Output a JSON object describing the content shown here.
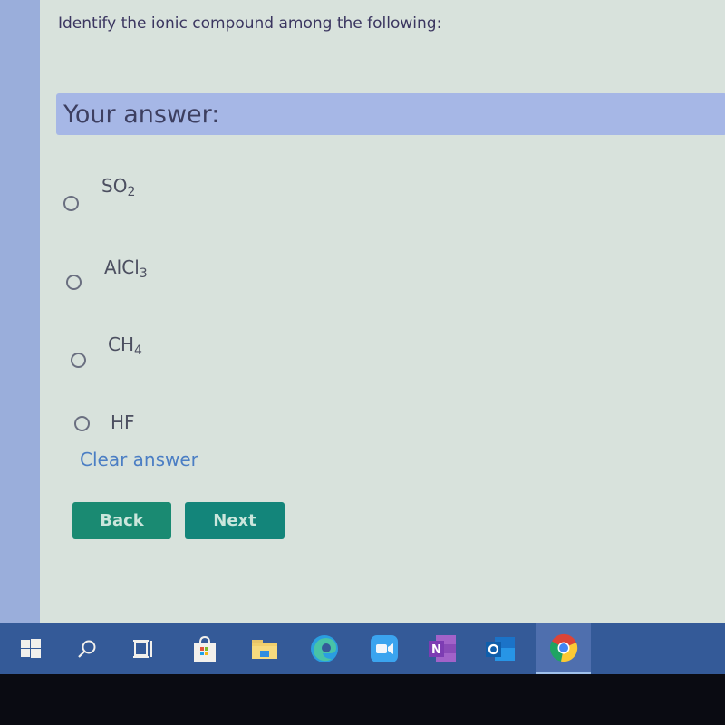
{
  "question": {
    "text": "Identify the ionic compound among the following:"
  },
  "answer_section": {
    "heading": "Your answer:"
  },
  "options": [
    {
      "base": "SO",
      "subscript": "2",
      "selected": false
    },
    {
      "base": "AlCl",
      "subscript": "3",
      "selected": false
    },
    {
      "base": "CH",
      "subscript": "4",
      "selected": false
    },
    {
      "base": "HF",
      "subscript": "",
      "selected": false
    }
  ],
  "clear_answer_label": "Clear answer",
  "buttons": {
    "back_label": "Back",
    "next_label": "Next"
  },
  "colors": {
    "button_bg": "#1a8a72",
    "answer_band": "#a6b7e6",
    "link": "#4b7ec4",
    "taskbar": "#345a98"
  },
  "taskbar": {
    "items": [
      {
        "icon": "windows-start-icon"
      },
      {
        "icon": "search-icon"
      },
      {
        "icon": "task-view-icon"
      },
      {
        "icon": "microsoft-store-icon"
      },
      {
        "icon": "file-explorer-icon"
      },
      {
        "icon": "edge-icon"
      },
      {
        "icon": "zoom-icon"
      },
      {
        "icon": "onenote-icon"
      },
      {
        "icon": "outlook-icon"
      },
      {
        "icon": "chrome-icon",
        "active": true
      }
    ]
  }
}
